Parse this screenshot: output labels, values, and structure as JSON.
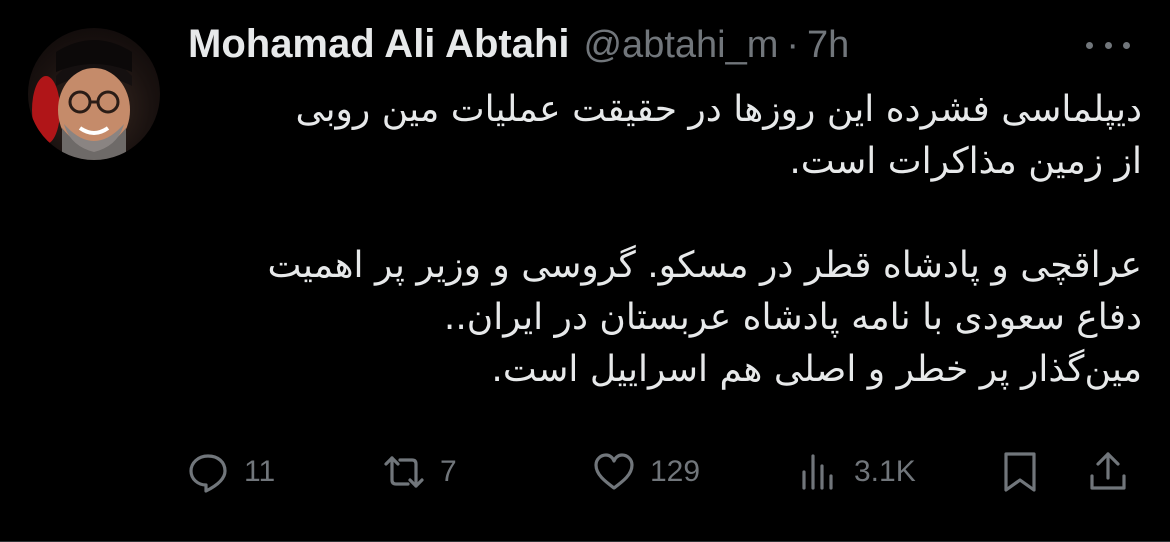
{
  "tweet": {
    "author": {
      "display_name": "Mohamad Ali Abtahi",
      "handle": "@abtahi_m",
      "separator": "·",
      "time": "7h"
    },
    "lines": [
      "دیپلماسی فشرده این روزها در حقیقت عملیات مین روبی",
      "از زمین مذاکرات است.",
      "",
      "عراقچی و پادشاه قطر در مسکو. گروسی و وزیر پر اهمیت",
      "دفاع سعودی با نامه پادشاه عربستان در ایران..",
      "مین‌گذار پر خطر و اصلی هم اسراییل است."
    ],
    "actions": {
      "replies": "11",
      "reposts": "7",
      "likes": "129",
      "views": "3.1K"
    },
    "icons": {
      "more": "more-horizontal-icon",
      "reply": "reply-icon",
      "repost": "repost-icon",
      "like": "heart-icon",
      "views": "analytics-icon",
      "bookmark": "bookmark-icon",
      "share": "share-icon"
    },
    "colors": {
      "background": "#000000",
      "text": "#e7e9ea",
      "muted": "#71767b"
    }
  }
}
